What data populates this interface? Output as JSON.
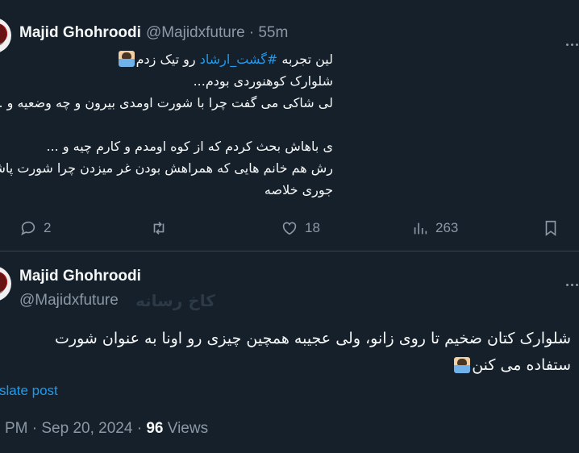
{
  "tweet1": {
    "author_name": "Majid Ghohroodi",
    "handle": "@Majidxfuture",
    "time": "· 55m",
    "lines": [
      [
        "لین تجربه ",
        "#گشت_ارشاد",
        " رو تیک زدم"
      ],
      "شلوارک کوهنوردی بودم...",
      "لی شاکی می گفت چرا با شورت اومدی بیرون و چه وضعیه و ...",
      "",
      "ی باهاش بحث کردم که از کوه اومدم و کارم چیه و ...",
      "رش هم خانم هایی که همراهش بودن غر میزدن چرا شورت پاشه...",
      "جوری خلاصه"
    ],
    "actions": {
      "reply_count": "2",
      "retweet_count": "",
      "like_count": "18",
      "views_count": "263"
    }
  },
  "tweet2": {
    "author_name": "Majid Ghohroodi",
    "handle": "@Majidxfuture",
    "watermark": "کاخ رسانه",
    "line1": "شلوارک کتان ضخیم تا روی زانو، ولی عجیبه همچین چیزی رو اونا به عنوان شورت",
    "line2": "ستفاده می کنن",
    "translate": "slate post",
    "time": "PM · Sep 20, 2024 · ",
    "views_count": "96",
    "views_label": " Views"
  },
  "icons": {
    "reply": "reply-icon",
    "retweet": "retweet-icon",
    "like": "heart-icon",
    "views": "views-icon",
    "bookmark": "bookmark-icon",
    "more": "more-icon",
    "emoji": "person-gesturing-emoji"
  },
  "colors": {
    "background": "#15202b",
    "text": "#f7f9f9",
    "muted": "#8b98a5",
    "accent": "#1d9bf0",
    "divider": "#38444d"
  }
}
